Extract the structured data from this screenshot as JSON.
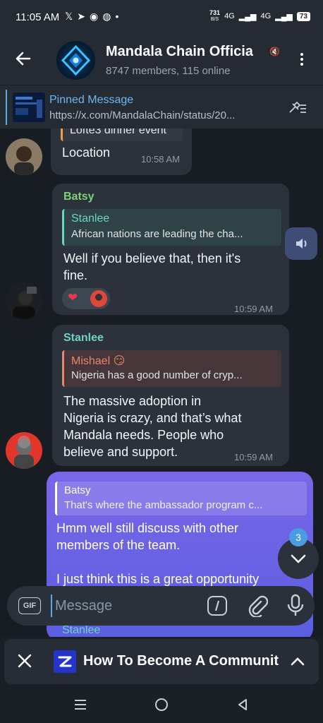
{
  "status_bar": {
    "time": "11:05 AM",
    "notification_icons": [
      "x-icon",
      "telegram-icon",
      "whatsapp-icon",
      "discord-icon",
      "dot-icon"
    ],
    "speed_value": "731",
    "speed_unit": "B/S",
    "network_1": "4G",
    "network_2": "4G",
    "battery": "73"
  },
  "header": {
    "title": "Mandala Chain Officia",
    "subtitle": "8747 members, 115 online"
  },
  "pinned": {
    "title": "Pinned Message",
    "text": "https://x.com/MandalaChain/status/20..."
  },
  "messages": [
    {
      "reply_text": "Lofte3 dinner event",
      "text": "Location",
      "time": "10:58 AM"
    },
    {
      "sender": "Batsy",
      "reply_name": "Stanlee",
      "reply_text": "African nations are leading the cha...",
      "text_lines": [
        "Well if you believe that, then it's",
        "fine."
      ],
      "reaction": "❤",
      "time": "10:59 AM"
    },
    {
      "sender": "Stanlee",
      "reply_name": "Mishael 😏",
      "reply_text": "Nigeria has a good number of cryp...",
      "text_lines": [
        "The massive adoption in",
        "Nigeria is crazy, and that’s what",
        "Mandala needs. People who",
        "believe and support."
      ],
      "time": "10:59 AM"
    },
    {
      "reply_name": "Batsy",
      "reply_text": "That's where the ambassador program c...",
      "text_lines": [
        "Hmm well still discuss with other",
        "members of the team.",
        "",
        "I just think this is a great opportunity"
      ]
    }
  ],
  "scroll_badge": "3",
  "input": {
    "placeholder": "Message",
    "gif_label": "GIF"
  },
  "partial_sender": "Stanlee",
  "bottom_panel": {
    "text": "How To Become A Communit"
  },
  "colors": {
    "accent": "#5fa8e6",
    "own_bubble": "#6c5ce7",
    "batsy": "#7fd07a",
    "stanlee": "#6fd3c3",
    "mishael": "#e8876a"
  }
}
